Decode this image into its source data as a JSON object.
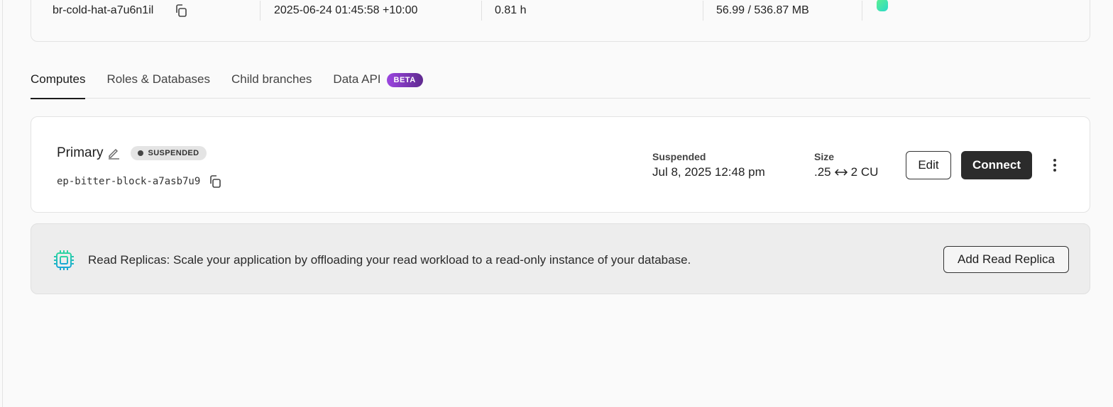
{
  "branch_summary": {
    "branch_id": "br-cold-hat-a7u6n1il",
    "created": "2025-06-24 01:45:58 +10:00",
    "compute_hours": "0.81 h",
    "storage": "56.99 / 536.87 MB",
    "status_indicator_color": "#3ee6b0"
  },
  "tabs": [
    {
      "label": "Computes",
      "active": true
    },
    {
      "label": "Roles & Databases"
    },
    {
      "label": "Child branches"
    },
    {
      "label": "Data API",
      "badge": "BETA"
    }
  ],
  "compute": {
    "name": "Primary",
    "status": "SUSPENDED",
    "endpoint_id": "ep-bitter-block-a7asb7u9",
    "suspended_label": "Suspended",
    "suspended_value": "Jul 8, 2025 12:48 pm",
    "size_label": "Size",
    "size_min": ".25",
    "size_max": "2 CU",
    "edit_label": "Edit",
    "connect_label": "Connect"
  },
  "read_replicas": {
    "text": "Read Replicas: Scale your application by offloading your read workload to a read-only instance of your database.",
    "button_label": "Add Read Replica",
    "icon_color": "#1fb8c9"
  }
}
